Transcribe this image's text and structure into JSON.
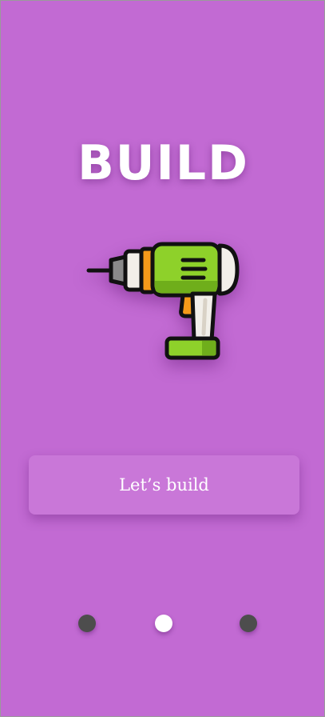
{
  "screen": {
    "title": "BUILD",
    "illustration": "power-drill-icon",
    "cta_label": "Let’s build"
  },
  "pagination": {
    "total": 3,
    "active_index": 2,
    "colors": {
      "active": "#ffffff",
      "inactive": "#4d4d4d"
    }
  },
  "theme": {
    "background": "#c26ad3",
    "button_background": "#c977d8",
    "drill_body": "#8ed12a",
    "drill_accent": "#f59a1a"
  }
}
